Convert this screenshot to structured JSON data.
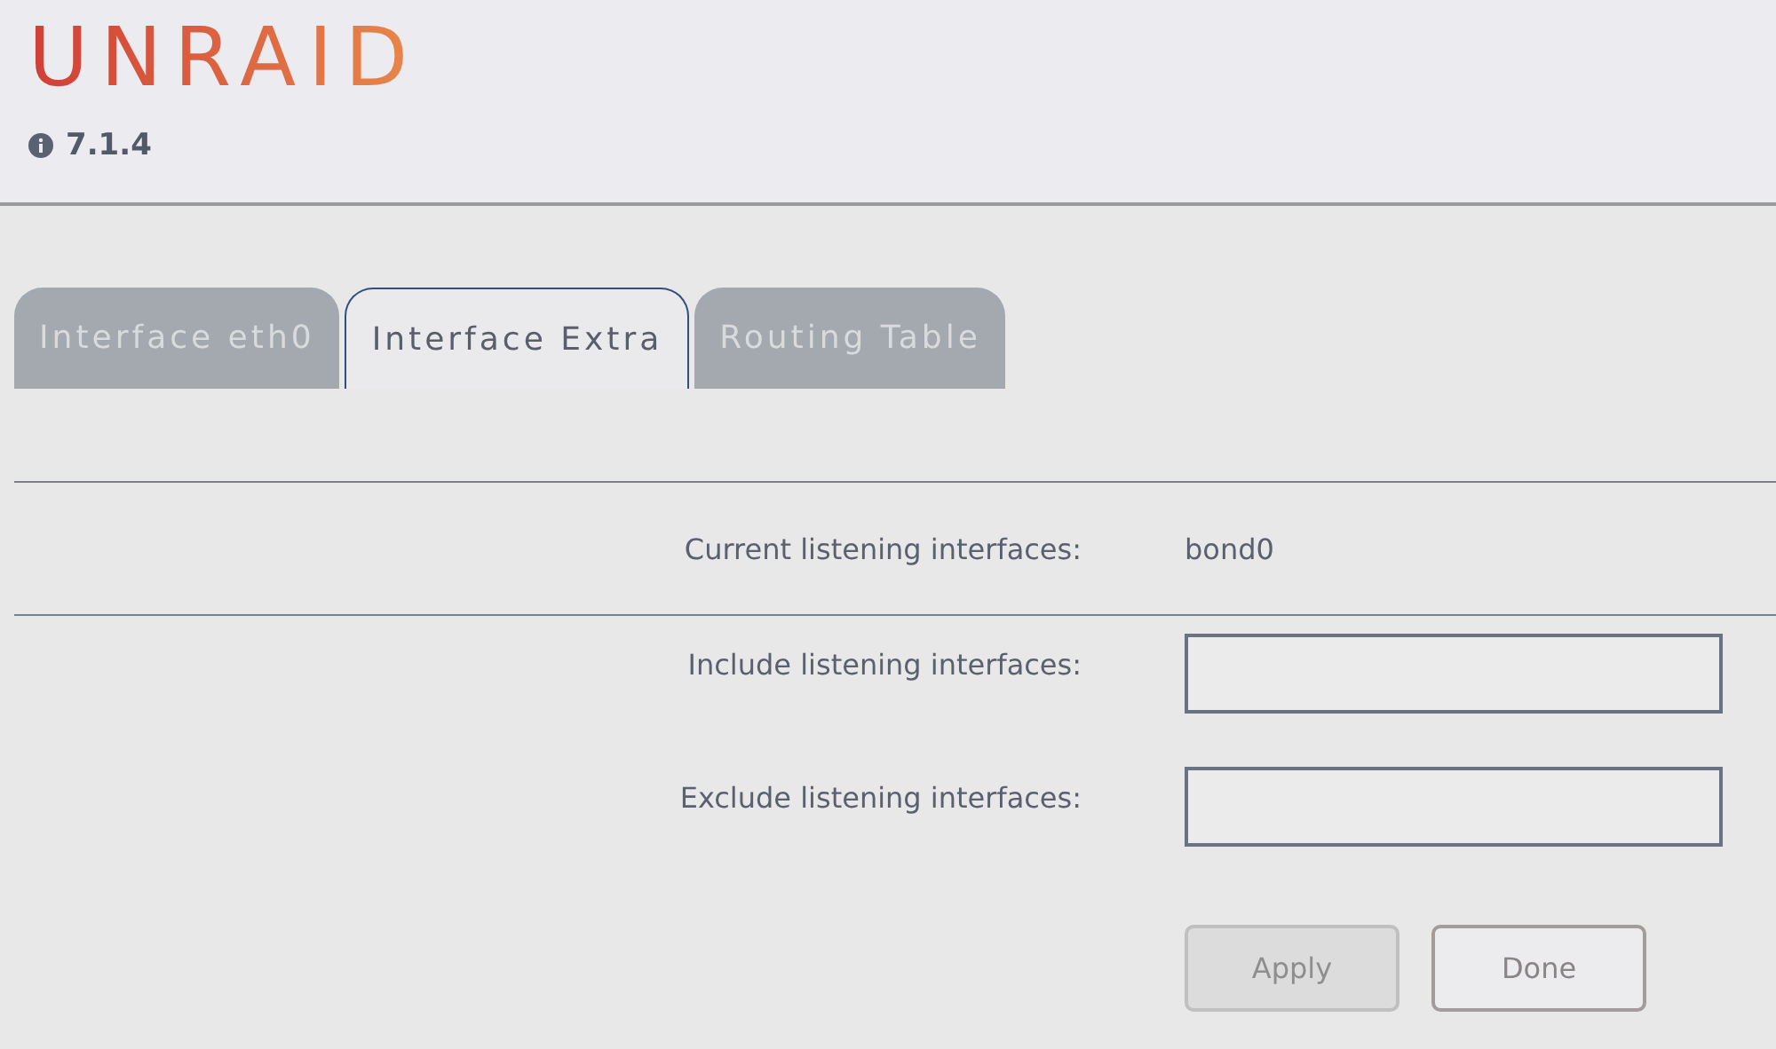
{
  "logo": "UNRAID",
  "version": "7.1.4",
  "tabs": [
    {
      "label": "Interface eth0",
      "selected": false
    },
    {
      "label": "Interface Extra",
      "selected": true
    },
    {
      "label": "Routing Table",
      "selected": false
    }
  ],
  "info": {
    "label": "Current listening interfaces:",
    "value": "bond0"
  },
  "fields": [
    {
      "label": "Include listening interfaces:"
    },
    {
      "label": "Exclude listening interfaces:"
    }
  ],
  "buttons": [
    {
      "label": "Apply",
      "disabled": true
    },
    {
      "label": "Done",
      "disabled": false
    }
  ]
}
